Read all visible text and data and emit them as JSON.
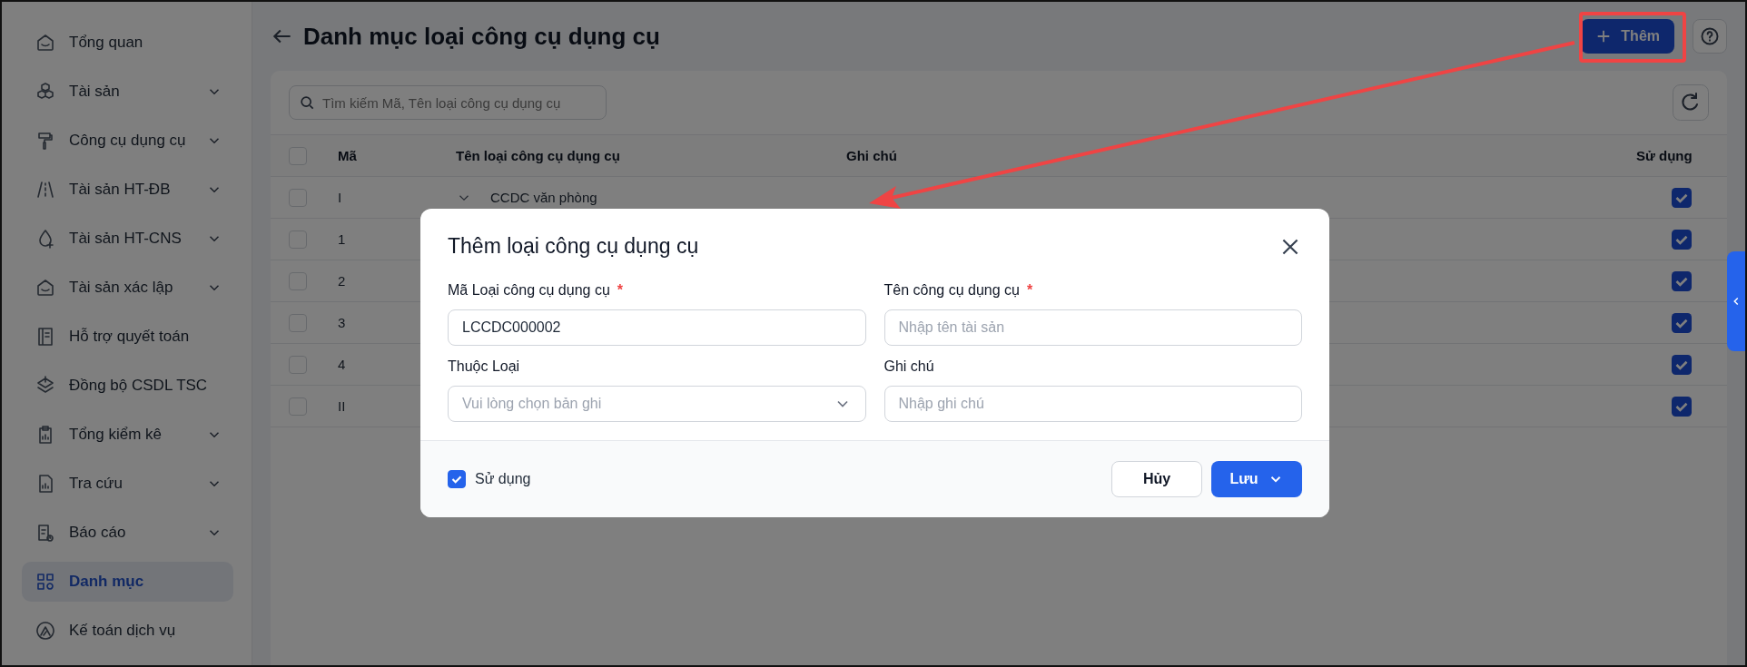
{
  "sidebar": {
    "items": [
      {
        "label": "Tổng quan",
        "expandable": false,
        "selected": false
      },
      {
        "label": "Tài sản",
        "expandable": true,
        "selected": false
      },
      {
        "label": "Công cụ dụng cụ",
        "expandable": true,
        "selected": false
      },
      {
        "label": "Tài sản HT-ĐB",
        "expandable": true,
        "selected": false
      },
      {
        "label": "Tài sản HT-CNS",
        "expandable": true,
        "selected": false
      },
      {
        "label": "Tài sản xác lập",
        "expandable": true,
        "selected": false
      },
      {
        "label": "Hỗ trợ quyết toán",
        "expandable": false,
        "selected": false
      },
      {
        "label": "Đồng bộ CSDL TSC",
        "expandable": false,
        "selected": false
      },
      {
        "label": "Tổng kiểm kê",
        "expandable": true,
        "selected": false
      },
      {
        "label": "Tra cứu",
        "expandable": true,
        "selected": false
      },
      {
        "label": "Báo cáo",
        "expandable": true,
        "selected": false
      },
      {
        "label": "Danh mục",
        "expandable": false,
        "selected": true
      },
      {
        "label": "Kế toán dịch vụ",
        "expandable": false,
        "selected": false
      }
    ]
  },
  "header": {
    "title": "Danh mục loại công cụ dụng cụ",
    "add_button": "Thêm"
  },
  "search": {
    "placeholder": "Tìm kiếm Mã, Tên loại công cụ dụng cụ"
  },
  "table": {
    "all_checked": false,
    "columns": [
      "Mã",
      "Tên loại công cụ dụng cụ",
      "Ghi chú",
      "Sử dụng"
    ],
    "rows": [
      {
        "code": "I",
        "name": "CCDC văn phòng",
        "expandable": true,
        "checked": false,
        "in_use": true
      },
      {
        "code": "1",
        "checked": false,
        "in_use": true
      },
      {
        "code": "2",
        "checked": false,
        "in_use": true
      },
      {
        "code": "3",
        "checked": false,
        "in_use": true
      },
      {
        "code": "4",
        "checked": false,
        "in_use": true
      },
      {
        "code": "II",
        "checked": false,
        "in_use": true
      }
    ]
  },
  "modal": {
    "title": "Thêm loại công cụ dụng cụ",
    "fields": [
      {
        "kind": "text",
        "label": "Mã Loại công cụ dụng cụ",
        "required_mark": "*",
        "value": "LCCDC000002"
      },
      {
        "kind": "text",
        "label": "Tên công cụ dụng cụ",
        "required_mark": "*",
        "placeholder": "Nhập tên tài sản"
      },
      {
        "kind": "select",
        "label": "Thuộc Loại",
        "placeholder": "Vui lòng chọn bản ghi"
      },
      {
        "kind": "text",
        "label": "Ghi chú",
        "placeholder": "Nhập ghi chú"
      }
    ],
    "in_use": {
      "label": "Sử dụng",
      "checked": true
    },
    "cancel_button": "Hủy",
    "save_button": "Lưu"
  },
  "annotation": {
    "highlight_add_button": true
  }
}
